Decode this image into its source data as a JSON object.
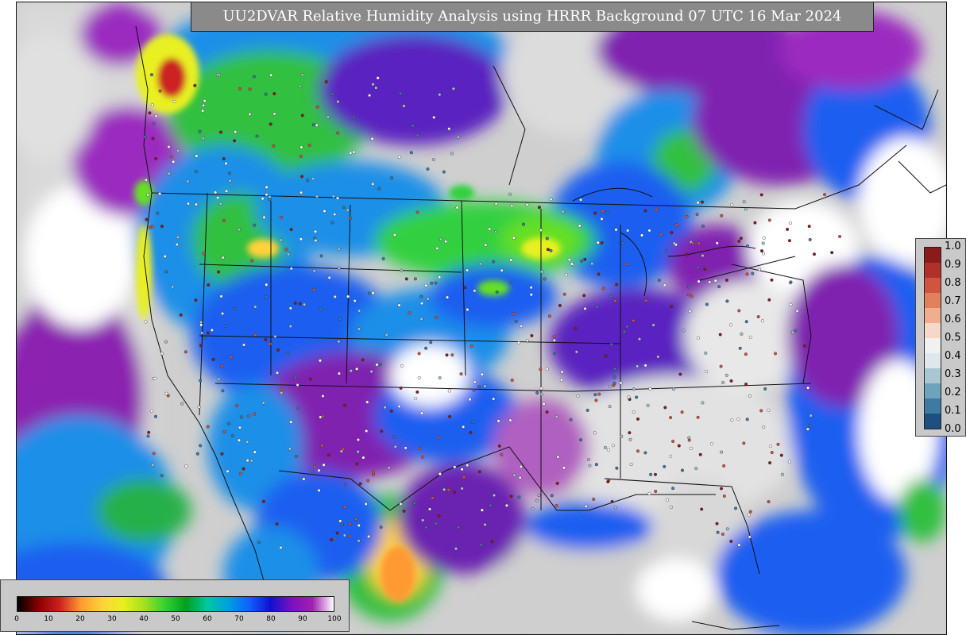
{
  "title": "UU2DVAR Relative Humidity Analysis using HRRR Background 07 UTC 16 Mar 2024",
  "right_colorbar": {
    "ticks": [
      "1.0",
      "0.9",
      "0.8",
      "0.7",
      "0.6",
      "0.5",
      "0.4",
      "0.3",
      "0.2",
      "0.1",
      "0.0"
    ],
    "colors": [
      "#8b1a1a",
      "#b2302a",
      "#cf5540",
      "#e0805d",
      "#eeae8f",
      "#f5d8c8",
      "#f1f1f1",
      "#dfe7ec",
      "#a8c7d2",
      "#6fa3bc",
      "#3f7aa2",
      "#1f4f80"
    ]
  },
  "bottom_colorbar": {
    "ticks": [
      "0",
      "10",
      "20",
      "30",
      "40",
      "50",
      "60",
      "70",
      "80",
      "90",
      "100"
    ],
    "colors": [
      "#000000",
      "#8b0000",
      "#cc2020",
      "#ff9a30",
      "#ffd23a",
      "#e8f020",
      "#a6e020",
      "#33d133",
      "#00a020",
      "#00c8a0",
      "#00a0e0",
      "#1060ff",
      "#1010d0",
      "#7a10c0",
      "#a020b0",
      "#ffffff"
    ]
  }
}
